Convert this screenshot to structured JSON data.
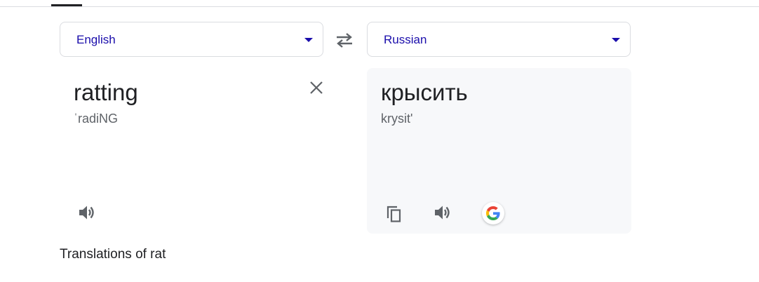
{
  "source": {
    "language": "English",
    "text": "ratting",
    "pronunciation": "ˈradiNG",
    "icons": {
      "clear": "close-icon",
      "speak": "speaker-icon"
    }
  },
  "target": {
    "language": "Russian",
    "text": "крысить",
    "transliteration": "krysit'",
    "icons": {
      "copy": "copy-icon",
      "speak": "speaker-icon",
      "google": "google-logo-icon"
    }
  },
  "swap_icon": "swap-arrows-icon",
  "translations_heading": "Translations of rat",
  "colors": {
    "language_link": "#1a0dab",
    "icon_gray": "#5f6368",
    "target_panel_bg": "#f7f8fa"
  }
}
